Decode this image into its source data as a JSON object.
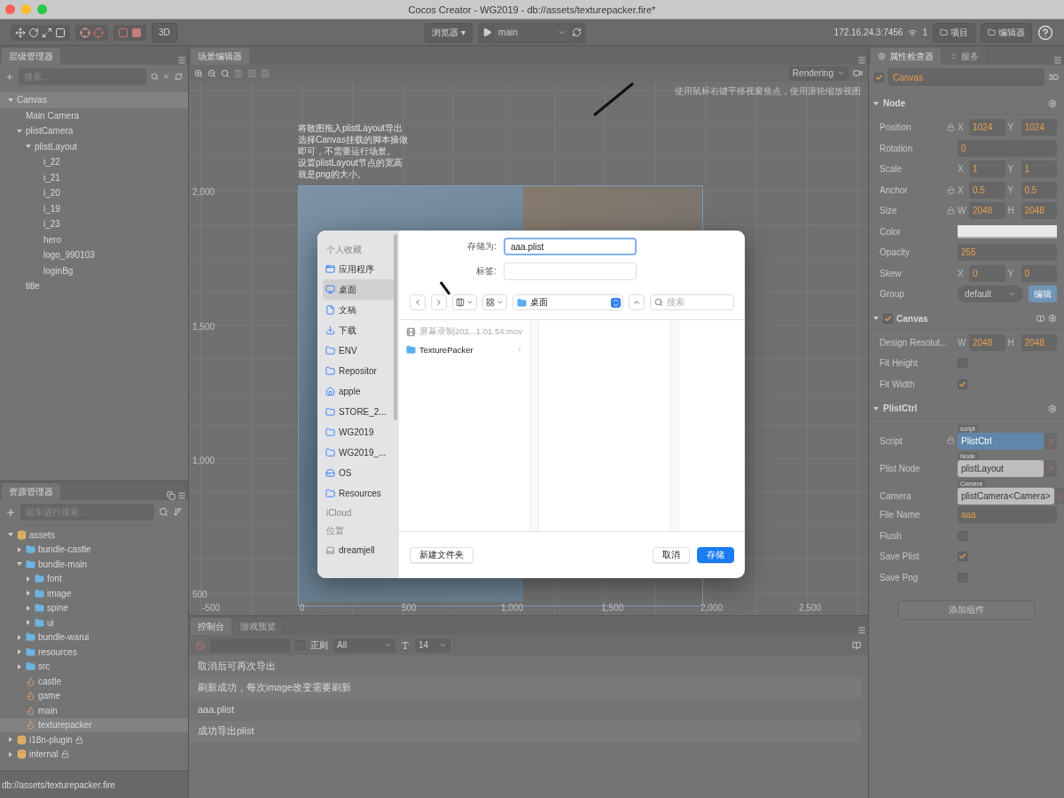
{
  "window": {
    "title": "Cocos Creator - WG2019 - db://assets/texturepacker.fire*"
  },
  "toolbar": {
    "mode_button": "3D",
    "preview_button": "浏览器 ▾",
    "scene_select": "main",
    "server": "172.16.24.3:7456",
    "connections": "1",
    "project_button": "项目",
    "editor_button": "编辑器"
  },
  "hierarchy": {
    "tab": "层级管理器",
    "search_placeholder": "搜索...",
    "nodes": [
      {
        "label": "Canvas",
        "selected": true,
        "expanded": true,
        "children": [
          {
            "label": "Main Camera",
            "selected": false
          },
          {
            "label": "plistCamera",
            "selected": false,
            "expanded": true,
            "children": [
              {
                "label": "plistLayout",
                "selected": false,
                "expanded": true,
                "children": [
                  {
                    "label": "i_22",
                    "selected": false
                  },
                  {
                    "label": "i_21",
                    "selected": false
                  },
                  {
                    "label": "i_20",
                    "selected": false
                  },
                  {
                    "label": "i_19",
                    "selected": false
                  },
                  {
                    "label": "i_23",
                    "selected": false
                  },
                  {
                    "label": "hero",
                    "selected": false
                  },
                  {
                    "label": "logo_990103",
                    "selected": false
                  },
                  {
                    "label": "loginBg",
                    "selected": false
                  }
                ]
              }
            ]
          },
          {
            "label": "title",
            "selected": false
          }
        ]
      }
    ]
  },
  "assets": {
    "tab": "资源管理器",
    "search_placeholder": "回车进行搜索...",
    "items": [
      {
        "kind": "db",
        "label": "assets",
        "expanded": true,
        "locked": false,
        "selected": false,
        "children": [
          {
            "kind": "folder",
            "label": "bundle-castle",
            "expanded": false,
            "locked": false,
            "selected": false
          },
          {
            "kind": "folder",
            "label": "bundle-main",
            "expanded": true,
            "locked": false,
            "selected": false,
            "children": [
              {
                "kind": "folder",
                "label": "font",
                "expanded": false,
                "locked": false,
                "selected": false
              },
              {
                "kind": "folder",
                "label": "image",
                "expanded": false,
                "locked": false,
                "selected": false
              },
              {
                "kind": "folder",
                "label": "spine",
                "expanded": false,
                "locked": false,
                "selected": false
              },
              {
                "kind": "folder",
                "label": "ui",
                "expanded": false,
                "locked": false,
                "selected": false
              }
            ]
          },
          {
            "kind": "folder",
            "label": "bundle-warui",
            "expanded": false,
            "locked": false,
            "selected": false
          },
          {
            "kind": "folder",
            "label": "resources",
            "expanded": false,
            "locked": false,
            "selected": false
          },
          {
            "kind": "folder",
            "label": "src",
            "expanded": false,
            "locked": false,
            "selected": false
          },
          {
            "kind": "scene",
            "label": "castle",
            "locked": false,
            "selected": false
          },
          {
            "kind": "scene",
            "label": "game",
            "locked": false,
            "selected": false
          },
          {
            "kind": "scene",
            "label": "main",
            "locked": false,
            "selected": false
          },
          {
            "kind": "scene",
            "label": "texturepacker",
            "locked": false,
            "selected": true
          }
        ]
      },
      {
        "kind": "db",
        "label": "i18n-plugin",
        "expanded": false,
        "locked": true,
        "selected": false
      },
      {
        "kind": "db",
        "label": "internal",
        "expanded": false,
        "locked": true,
        "selected": false
      }
    ]
  },
  "status_bar": "db://assets/texturepacker.fire",
  "scene": {
    "tab": "场景编辑器",
    "render_select": "Rendering",
    "hint": "使用鼠标右键平移视窗焦点，使用滚轮缩放视图",
    "note": [
      "将散图拖入plistLayout导出",
      "选择Canvas挂载的脚本操做",
      "即可，不需要运行场景。",
      "设置plistLayout节点的宽高",
      "就是png的大小。"
    ],
    "y_ticks": [
      "2,000",
      "1,500",
      "1,000",
      "500"
    ],
    "x_ticks": [
      "-500",
      "0",
      "500",
      "1,000",
      "1,500",
      "2,000",
      "2,500"
    ]
  },
  "console": {
    "tabs": [
      {
        "label": "控制台",
        "selected": true
      },
      {
        "label": "游戏预览",
        "selected": false
      }
    ],
    "regex_label": "正则",
    "regex_checked": false,
    "level_select": "All",
    "font_size": "14",
    "lines": [
      "取消后可再次导出",
      "刷新成功，每次image改变需要刷新",
      "aaa.plist",
      "成功导出plist"
    ]
  },
  "inspector": {
    "tabs": [
      {
        "label": "属性检查器",
        "selected": true
      },
      {
        "label": "服务",
        "selected": false
      }
    ],
    "node": {
      "enabled": true,
      "name": "Canvas",
      "mode": "3D"
    },
    "sections": [
      {
        "title": "Node",
        "props": [
          {
            "kind": "xy",
            "label": "Position",
            "locked": true,
            "a": "X",
            "av": "1024",
            "b": "Y",
            "bv": "1024"
          },
          {
            "kind": "text",
            "label": "Rotation",
            "value": "0"
          },
          {
            "kind": "xy",
            "label": "Scale",
            "locked": false,
            "a": "X",
            "av": "1",
            "b": "Y",
            "bv": "1"
          },
          {
            "kind": "xy",
            "label": "Anchor",
            "locked": true,
            "a": "X",
            "av": "0.5",
            "b": "Y",
            "bv": "0.5"
          },
          {
            "kind": "xy",
            "label": "Size",
            "locked": true,
            "a": "W",
            "av": "2048",
            "b": "H",
            "bv": "2048"
          },
          {
            "kind": "color",
            "label": "Color"
          },
          {
            "kind": "text",
            "label": "Opacity",
            "value": "255"
          },
          {
            "kind": "xy",
            "label": "Skew",
            "locked": false,
            "a": "X",
            "av": "0",
            "b": "Y",
            "bv": "0"
          },
          {
            "kind": "select",
            "label": "Group",
            "value": "default",
            "button": "编辑"
          }
        ]
      },
      {
        "title": "Canvas",
        "enabled": true,
        "props": [
          {
            "kind": "xy",
            "label": "Design Resolut...",
            "locked": false,
            "a": "W",
            "av": "2048",
            "b": "H",
            "bv": "2048"
          },
          {
            "kind": "check",
            "label": "Fit Height",
            "checked": false
          },
          {
            "kind": "check",
            "label": "Fit Width",
            "checked": true
          }
        ]
      },
      {
        "title": "PlistCtrl",
        "props": [
          {
            "kind": "ref",
            "label": "Script",
            "tag": "script",
            "value": "PlistCtrl",
            "locked": true,
            "highlighted": true
          },
          {
            "kind": "ref",
            "label": "Plist Node",
            "tag": "Node",
            "value": "plistLayout",
            "locked": false,
            "highlighted": false
          },
          {
            "kind": "ref",
            "label": "Camera",
            "tag": "Camera",
            "value": "plistCamera<Camera>",
            "locked": false,
            "highlighted": false
          },
          {
            "kind": "text",
            "label": "File Name",
            "value": "aaa"
          },
          {
            "kind": "check",
            "label": "Flush",
            "checked": false
          },
          {
            "kind": "check",
            "label": "Save Plist",
            "checked": true
          },
          {
            "kind": "check",
            "label": "Save Png",
            "checked": false
          }
        ]
      }
    ],
    "add_button": "添加组件"
  },
  "dialog": {
    "save_as_label": "存储为:",
    "filename": "aaa.plist",
    "tags_label": "标签:",
    "location": "桌面",
    "search_placeholder": "搜索",
    "sidebar": [
      {
        "kind": "header",
        "label": "个人收藏"
      },
      {
        "kind": "apps",
        "label": "应用程序",
        "selected": false
      },
      {
        "kind": "desktop",
        "label": "桌面",
        "selected": true
      },
      {
        "kind": "document",
        "label": "文稿",
        "selected": false
      },
      {
        "kind": "download",
        "label": "下载",
        "selected": false
      },
      {
        "kind": "folder",
        "label": "ENV",
        "selected": false
      },
      {
        "kind": "folder",
        "label": "Repositor",
        "selected": false
      },
      {
        "kind": "home",
        "label": "apple",
        "selected": false
      },
      {
        "kind": "folder",
        "label": "STORE_2...",
        "selected": false
      },
      {
        "kind": "folder",
        "label": "WG2019",
        "selected": false
      },
      {
        "kind": "folder",
        "label": "WG2019_...",
        "selected": false
      },
      {
        "kind": "disk",
        "label": "OS",
        "selected": false
      },
      {
        "kind": "folder",
        "label": "Resources",
        "selected": false
      },
      {
        "kind": "header",
        "label": "iCloud"
      },
      {
        "kind": "header",
        "label": "位置"
      },
      {
        "kind": "computer",
        "label": "dreamjell",
        "selected": false
      }
    ],
    "files": [
      {
        "kind": "video",
        "label": "屏幕录制202...1.01.54.mov",
        "disabled": true
      },
      {
        "kind": "folder",
        "label": "TexturePacker",
        "disabled": false
      }
    ],
    "new_folder_button": "新建文件夹",
    "cancel_button": "取消",
    "save_button": "存储"
  }
}
